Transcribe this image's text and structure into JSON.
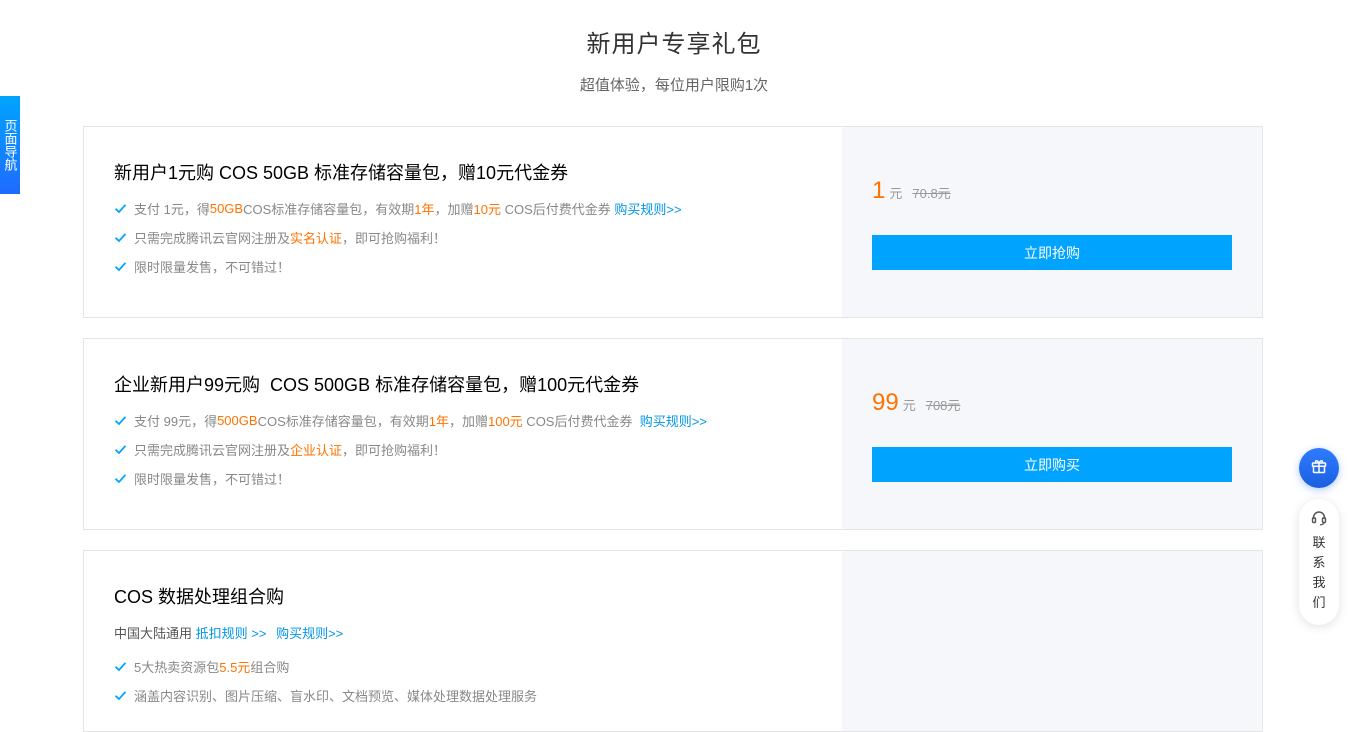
{
  "header": {
    "title": "新用户专享礼包",
    "subtitle": "超值体验，每位用户限购1次"
  },
  "side_nav": {
    "label": "页面导航"
  },
  "cards": [
    {
      "title": "新用户1元购 COS 50GB 标准存储容量包，赠10元代金券",
      "features": [
        {
          "parts": [
            "支付 1元，得 ",
            "50GB",
            "  COS标准存储容量包，有效期 ",
            "1年",
            "，加赠 ",
            "10元",
            " COS后付费代金券 ",
            "购买规则>>"
          ]
        },
        {
          "parts": [
            "只需完成腾讯云官网注册及",
            "实名认证",
            "，即可抢购福利！"
          ]
        },
        {
          "parts": [
            "限时限量发售，不可错过！"
          ]
        }
      ],
      "price": "1",
      "unit": "元",
      "original_price": "70.8元",
      "button": "立即抢购"
    },
    {
      "title": "企业新用户99元购  COS 500GB 标准存储容量包，赠100元代金券",
      "features": [
        {
          "parts": [
            "支付 99元，得 ",
            "500GB",
            " COS标准存储容量包，有效期 ",
            "1年",
            "，加赠 ",
            "100元",
            " COS后付费代金券  ",
            "购买规则>>"
          ]
        },
        {
          "parts": [
            "只需完成腾讯云官网注册及",
            "企业认证",
            "，即可抢购福利！"
          ]
        },
        {
          "parts": [
            "限时限量发售，不可错过！"
          ]
        }
      ],
      "price": "99",
      "unit": "元",
      "original_price": "708元",
      "button": "立即购买"
    },
    {
      "title": "COS 数据处理组合购",
      "region": "中国大陆通用",
      "region_link1": "抵扣规则 >>",
      "region_link2": "购买规则>>",
      "features": [
        {
          "parts": [
            "5大热卖资源包 ",
            "5.5元",
            "组合购"
          ]
        },
        {
          "parts": [
            "涵盖内容识别、图片压缩、盲水印、文档预览、媒体处理数据处理服务"
          ]
        }
      ]
    }
  ],
  "float_panel": {
    "gift_icon": "gift-icon",
    "contact_icon": "headset-icon",
    "contact_label": "联系我们"
  },
  "colors": {
    "accent_blue": "#00a4ff",
    "highlight_orange": "#ff7200",
    "link_blue": "#0096e6",
    "right_panel_bg": "#f5f7fa"
  }
}
